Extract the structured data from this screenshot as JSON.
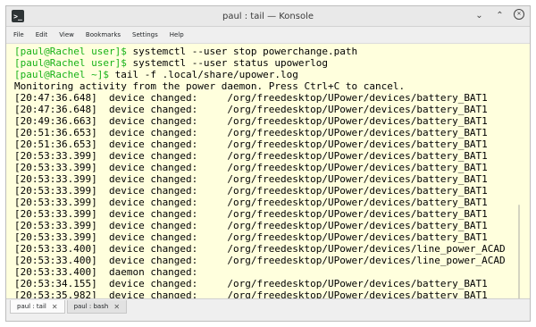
{
  "window": {
    "title": "paul : tail — Konsole",
    "app_icon": ">_",
    "minimize_glyph": "⌄",
    "maximize_glyph": "⌃",
    "close_glyph": "✕"
  },
  "menubar": [
    "File",
    "Edit",
    "View",
    "Bookmarks",
    "Settings",
    "Help"
  ],
  "terminal": {
    "prompts": [
      {
        "prompt": "[paul@Rachel user]$",
        "command": " systemctl --user stop powerchange.path"
      },
      {
        "prompt": "[paul@Rachel user]$",
        "command": " systemctl --user status upowerlog"
      },
      {
        "prompt": "[paul@Rachel ~]$",
        "command": " tail -f .local/share/upower.log"
      }
    ],
    "output": [
      "Monitoring activity from the power daemon. Press Ctrl+C to cancel.",
      "[20:47:36.648]  device changed:     /org/freedesktop/UPower/devices/battery_BAT1",
      "[20:47:36.648]  device changed:     /org/freedesktop/UPower/devices/battery_BAT1",
      "[20:49:36.663]  device changed:     /org/freedesktop/UPower/devices/battery_BAT1",
      "[20:51:36.653]  device changed:     /org/freedesktop/UPower/devices/battery_BAT1",
      "[20:51:36.653]  device changed:     /org/freedesktop/UPower/devices/battery_BAT1",
      "[20:53:33.399]  device changed:     /org/freedesktop/UPower/devices/battery_BAT1",
      "[20:53:33.399]  device changed:     /org/freedesktop/UPower/devices/battery_BAT1",
      "[20:53:33.399]  device changed:     /org/freedesktop/UPower/devices/battery_BAT1",
      "[20:53:33.399]  device changed:     /org/freedesktop/UPower/devices/battery_BAT1",
      "[20:53:33.399]  device changed:     /org/freedesktop/UPower/devices/battery_BAT1",
      "[20:53:33.399]  device changed:     /org/freedesktop/UPower/devices/battery_BAT1",
      "[20:53:33.399]  device changed:     /org/freedesktop/UPower/devices/battery_BAT1",
      "[20:53:33.399]  device changed:     /org/freedesktop/UPower/devices/battery_BAT1",
      "[20:53:33.400]  device changed:     /org/freedesktop/UPower/devices/line_power_ACAD",
      "[20:53:33.400]  device changed:     /org/freedesktop/UPower/devices/line_power_ACAD",
      "[20:53:33.400]  daemon changed:",
      "[20:53:34.155]  device changed:     /org/freedesktop/UPower/devices/battery_BAT1",
      "[20:53:35.982]  device changed:     /org/freedesktop/UPower/devices/battery_BAT1"
    ]
  },
  "tabs": [
    {
      "label": "paul : tail",
      "close": "✕"
    },
    {
      "label": "paul : bash",
      "close": "✕"
    }
  ],
  "colors": {
    "terminal_bg": "#ffffdd",
    "prompt": "#18b218",
    "text": "#000000"
  }
}
